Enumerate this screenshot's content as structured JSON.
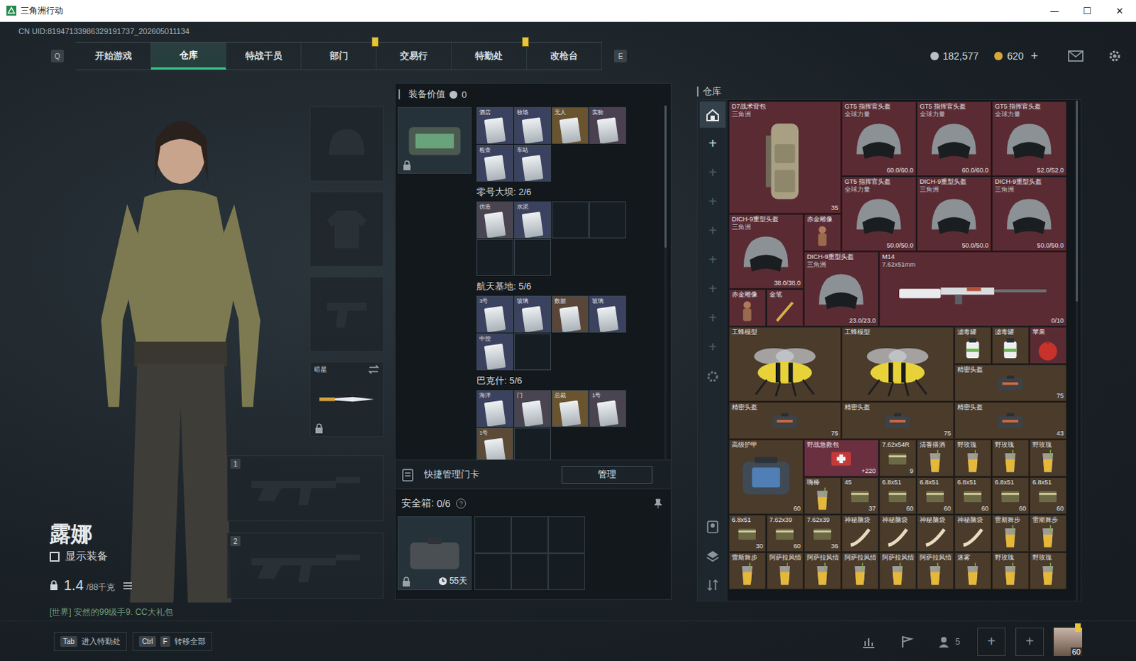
{
  "window": {
    "title": "三角洲行动",
    "controls": [
      "—",
      "☐",
      "✕"
    ]
  },
  "uid": "CN UID:81947133986329191737_202605011134",
  "nav": {
    "prev_key": "Q",
    "next_key": "E",
    "tabs": [
      {
        "label": "开始游戏",
        "selected": false,
        "alert": false
      },
      {
        "label": "仓库",
        "selected": true,
        "alert": false
      },
      {
        "label": "特战干员",
        "selected": false,
        "alert": false
      },
      {
        "label": "部门",
        "selected": false,
        "alert": true
      },
      {
        "label": "交易行",
        "selected": false,
        "alert": false
      },
      {
        "label": "特勤处",
        "selected": false,
        "alert": true
      },
      {
        "label": "改枪台",
        "selected": false,
        "alert": false
      }
    ]
  },
  "currency": [
    {
      "kind": "silver",
      "amount": "182,577"
    },
    {
      "kind": "gold",
      "amount": "620",
      "add": "+"
    }
  ],
  "operator": {
    "name": "露娜",
    "show_gear": {
      "label": "显示装备",
      "checked": false
    },
    "weight": "1.4",
    "weight_max": "/88千克",
    "chat": "[世界] 安然的99级手9. CC大礼包"
  },
  "gear_slots": [
    {
      "kind": "helmet"
    },
    {
      "kind": "armor"
    },
    {
      "kind": "pistol"
    },
    {
      "kind": "melee",
      "label": "暗星",
      "locked": true
    }
  ],
  "weapon_slots": [
    "1",
    "2"
  ],
  "hotkeys": [
    {
      "keys": [
        "Tab"
      ],
      "label": "进入特勤处"
    },
    {
      "keys": [
        "Ctrl",
        "F"
      ],
      "label": "转移全部"
    }
  ],
  "equipment_value": {
    "label": "装备价值",
    "value": "0"
  },
  "keycards": {
    "locked": true,
    "groups": [
      {
        "slots": [
          {
            "label": "酒店",
            "color": "#3b4260"
          },
          {
            "label": "牧场",
            "color": "#3b4260"
          },
          {
            "label": "无人",
            "color": "#6a5430"
          },
          {
            "label": "实验",
            "color": "#4a4050"
          },
          {
            "label": "检查",
            "color": "#3b4260"
          },
          {
            "label": "车站",
            "color": "#3b4260"
          }
        ]
      },
      {
        "title": "零号大坝: 2/6",
        "slots": [
          {
            "label": "仿造",
            "color": "#4a4450"
          },
          {
            "label": "水泥",
            "color": "#3b4260"
          },
          {
            "empty": true
          },
          {
            "empty": true
          },
          {
            "empty": true
          },
          {
            "empty": true
          }
        ]
      },
      {
        "title": "航天基地: 5/6",
        "slots": [
          {
            "label": "3号",
            "color": "#3b4260"
          },
          {
            "label": "玻璃",
            "color": "#3b4260"
          },
          {
            "label": "数据",
            "color": "#5a4638"
          },
          {
            "label": "玻璃",
            "color": "#3b4260"
          },
          {
            "label": "中控",
            "color": "#3b4260"
          },
          {
            "empty": true
          }
        ]
      },
      {
        "title": "巴克什: 5/6",
        "slots": [
          {
            "label": "海洋",
            "color": "#3b4260"
          },
          {
            "label": "门",
            "color": "#4a4450"
          },
          {
            "label": "总裁",
            "color": "#6a5430"
          },
          {
            "label": "1号",
            "color": "#4a4450"
          },
          {
            "label": "1号",
            "color": "#5a4a36"
          },
          {
            "empty": true
          }
        ]
      }
    ]
  },
  "quick_manage": {
    "label": "快捷管理门卡",
    "button": "管理"
  },
  "safe_box": {
    "label": "安全箱:",
    "count": "0/6",
    "help": "?",
    "days": "55天",
    "locked": true,
    "slots": [
      {
        "filled": false
      },
      {
        "filled": false
      },
      {
        "filled": false
      },
      {
        "filled": false
      },
      {
        "filled": false
      },
      {
        "filled": false
      }
    ]
  },
  "warehouse": {
    "title": "仓库",
    "sidebar": [
      {
        "kind": "home",
        "selected": true
      },
      {
        "kind": "add",
        "label": "+",
        "enabled": true,
        "selected": false
      },
      {
        "kind": "add",
        "label": "+",
        "enabled": false,
        "selected": false
      },
      {
        "kind": "add",
        "label": "+",
        "enabled": false,
        "selected": false
      },
      {
        "kind": "add",
        "label": "+",
        "enabled": false,
        "selected": false
      },
      {
        "kind": "add",
        "label": "+",
        "enabled": false,
        "selected": false
      },
      {
        "kind": "add",
        "label": "+",
        "enabled": false,
        "selected": false
      },
      {
        "kind": "add",
        "label": "+",
        "enabled": false,
        "selected": false
      },
      {
        "kind": "add",
        "label": "+",
        "enabled": false,
        "selected": false
      },
      {
        "kind": "settings",
        "selected": false
      }
    ],
    "tools": [
      {
        "kind": "person"
      },
      {
        "kind": "layers"
      },
      {
        "kind": "sort"
      }
    ],
    "items": [
      {
        "name": "D7战术背包",
        "sub": "三角洲",
        "value": "35",
        "kind": "bag",
        "color": "#5a2b33"
      },
      {
        "name": "GT5 指挥官头盔",
        "sub": "全球力量",
        "value": "60.0/60.0",
        "kind": "helmet",
        "color": "#5a2b33"
      },
      {
        "name": "GT5 指挥官头盔",
        "sub": "全球力量",
        "value": "60.0/60.0",
        "kind": "helmet",
        "color": "#5a2b33"
      },
      {
        "name": "GT5 指挥官头盔",
        "sub": "全球力量",
        "value": "52.0/52.0",
        "kind": "helmet",
        "color": "#5a2b33"
      },
      {
        "name": "GT5 指挥官头盔",
        "sub": "全球力量",
        "value": "50.0/50.0",
        "kind": "helmet",
        "color": "#5a2b33"
      },
      {
        "name": "DICH-9重型头盔",
        "sub": "三角洲",
        "value": "50.0/50.0",
        "kind": "helmet",
        "color": "#5a2b33"
      },
      {
        "name": "DICH-9重型头盔",
        "sub": "三角洲",
        "value": "50.0/50.0",
        "kind": "helmet",
        "color": "#5a2b33"
      },
      {
        "name": "DICH-9重型头盔",
        "sub": "三角洲",
        "value": "38.0/38.0",
        "kind": "helmet",
        "color": "#5a2b33"
      },
      {
        "name": "赤金雕像",
        "kind": "statue",
        "color": "#5a2b33"
      },
      {
        "name": "DICH-9重型头盔",
        "sub": "三角洲",
        "value": "23.0/23.0",
        "kind": "helmet",
        "color": "#5a2b33"
      },
      {
        "name": "M14",
        "sub": "7.62x51mm",
        "value": "0/10",
        "kind": "rifle",
        "color": "#5a2b33"
      },
      {
        "name": "赤金雕像",
        "kind": "statue",
        "color": "#5a2b33"
      },
      {
        "name": "金笔",
        "kind": "pen",
        "color": "#5a2b33"
      },
      {
        "name": "工蜂模型",
        "kind": "model",
        "color": "#4a3b2b"
      },
      {
        "name": "工蜂模型",
        "kind": "model",
        "color": "#4a3b2b"
      },
      {
        "name": "滤毒罐",
        "kind": "can",
        "color": "#4a3b2b"
      },
      {
        "name": "滤毒罐",
        "kind": "can",
        "color": "#4a3b2b"
      },
      {
        "name": "苹果",
        "kind": "fruit",
        "color": "#5a2b33"
      },
      {
        "name": "精密头盔",
        "value": "75",
        "kind": "case",
        "color": "#4a3b2b"
      },
      {
        "name": "精密头盔",
        "value": "75",
        "kind": "case",
        "color": "#4a3b2b"
      },
      {
        "name": "精密头盔",
        "value": "75",
        "kind": "case",
        "color": "#4a3b2b"
      },
      {
        "name": "精密头盔",
        "value": "43",
        "kind": "case",
        "color": "#4a3b2b"
      },
      {
        "name": "高级护甲",
        "value": "60",
        "kind": "armor",
        "color": "#4a3b2b"
      },
      {
        "name": "野战急救包",
        "value": "+220",
        "kind": "kit",
        "color": "#6a3040"
      },
      {
        "name": "7.62x54R",
        "value": "9",
        "kind": "ammo",
        "color": "#4a3b2b"
      },
      {
        "name": "清香搭酒",
        "kind": "drink",
        "color": "#4a3b2b"
      },
      {
        "name": "野玫瑰",
        "kind": "drink",
        "color": "#4a3b2b"
      },
      {
        "name": "野玫瑰",
        "kind": "drink",
        "color": "#4a3b2b"
      },
      {
        "name": "野玫瑰",
        "kind": "drink",
        "color": "#4a3b2b"
      },
      {
        "name": "嗨棒",
        "kind": "drink",
        "color": "#4a3b2b"
      },
      {
        "name": "45",
        "value": "37",
        "kind": "ammo",
        "color": "#4a3b2b"
      },
      {
        "name": "6.8x51",
        "value": "60",
        "kind": "ammo",
        "color": "#4a3b2b"
      },
      {
        "name": "6.8x51",
        "value": "60",
        "kind": "ammo",
        "color": "#4a3b2b"
      },
      {
        "name": "6.8x51",
        "value": "60",
        "kind": "ammo",
        "color": "#4a3b2b"
      },
      {
        "name": "6.8x51",
        "value": "60",
        "kind": "ammo",
        "color": "#4a3b2b"
      },
      {
        "name": "6.8x51",
        "value": "60",
        "kind": "ammo",
        "color": "#4a3b2b"
      },
      {
        "name": "6.8x51",
        "value": "30",
        "kind": "ammo",
        "color": "#4a3b2b"
      },
      {
        "name": "7.62x39",
        "value": "60",
        "kind": "ammo",
        "color": "#4a3b2b"
      },
      {
        "name": "7.62x39",
        "value": "36",
        "kind": "ammo",
        "color": "#4a3b2b"
      },
      {
        "name": "神秘脑袋",
        "kind": "scroll",
        "color": "#4a3b2b"
      },
      {
        "name": "神秘脑袋",
        "kind": "scroll",
        "color": "#4a3b2b"
      },
      {
        "name": "神秘脑袋",
        "kind": "scroll",
        "color": "#4a3b2b"
      },
      {
        "name": "神秘脑袋",
        "kind": "scroll",
        "color": "#4a3b2b"
      },
      {
        "name": "雷斯舞步",
        "kind": "drink",
        "color": "#4a3b2b"
      },
      {
        "name": "雷斯舞步",
        "kind": "drink",
        "color": "#4a3b2b"
      },
      {
        "name": "雷斯舞步",
        "kind": "drink",
        "color": "#4a3b2b"
      },
      {
        "name": "阿萨拉风情",
        "kind": "drink",
        "color": "#4a3b2b"
      },
      {
        "name": "阿萨拉风情",
        "kind": "drink",
        "color": "#4a3b2b"
      },
      {
        "name": "阿萨拉风情",
        "kind": "drink",
        "color": "#4a3b2b"
      },
      {
        "name": "阿萨拉风情",
        "kind": "drink",
        "color": "#4a3b2b"
      },
      {
        "name": "阿萨拉风情",
        "kind": "drink",
        "color": "#4a3b2b"
      },
      {
        "name": "迷雾",
        "kind": "drink",
        "color": "#4a3b2b"
      },
      {
        "name": "野玫瑰",
        "kind": "drink",
        "color": "#4a3b2b"
      },
      {
        "name": "野玫瑰",
        "kind": "drink",
        "color": "#4a3b2b"
      }
    ]
  },
  "footer": {
    "tools": [
      {
        "kind": "stats"
      },
      {
        "kind": "flag"
      },
      {
        "kind": "friends",
        "label": "5"
      }
    ],
    "add_slots": [
      "+",
      "+"
    ],
    "avatar_level": "60"
  }
}
